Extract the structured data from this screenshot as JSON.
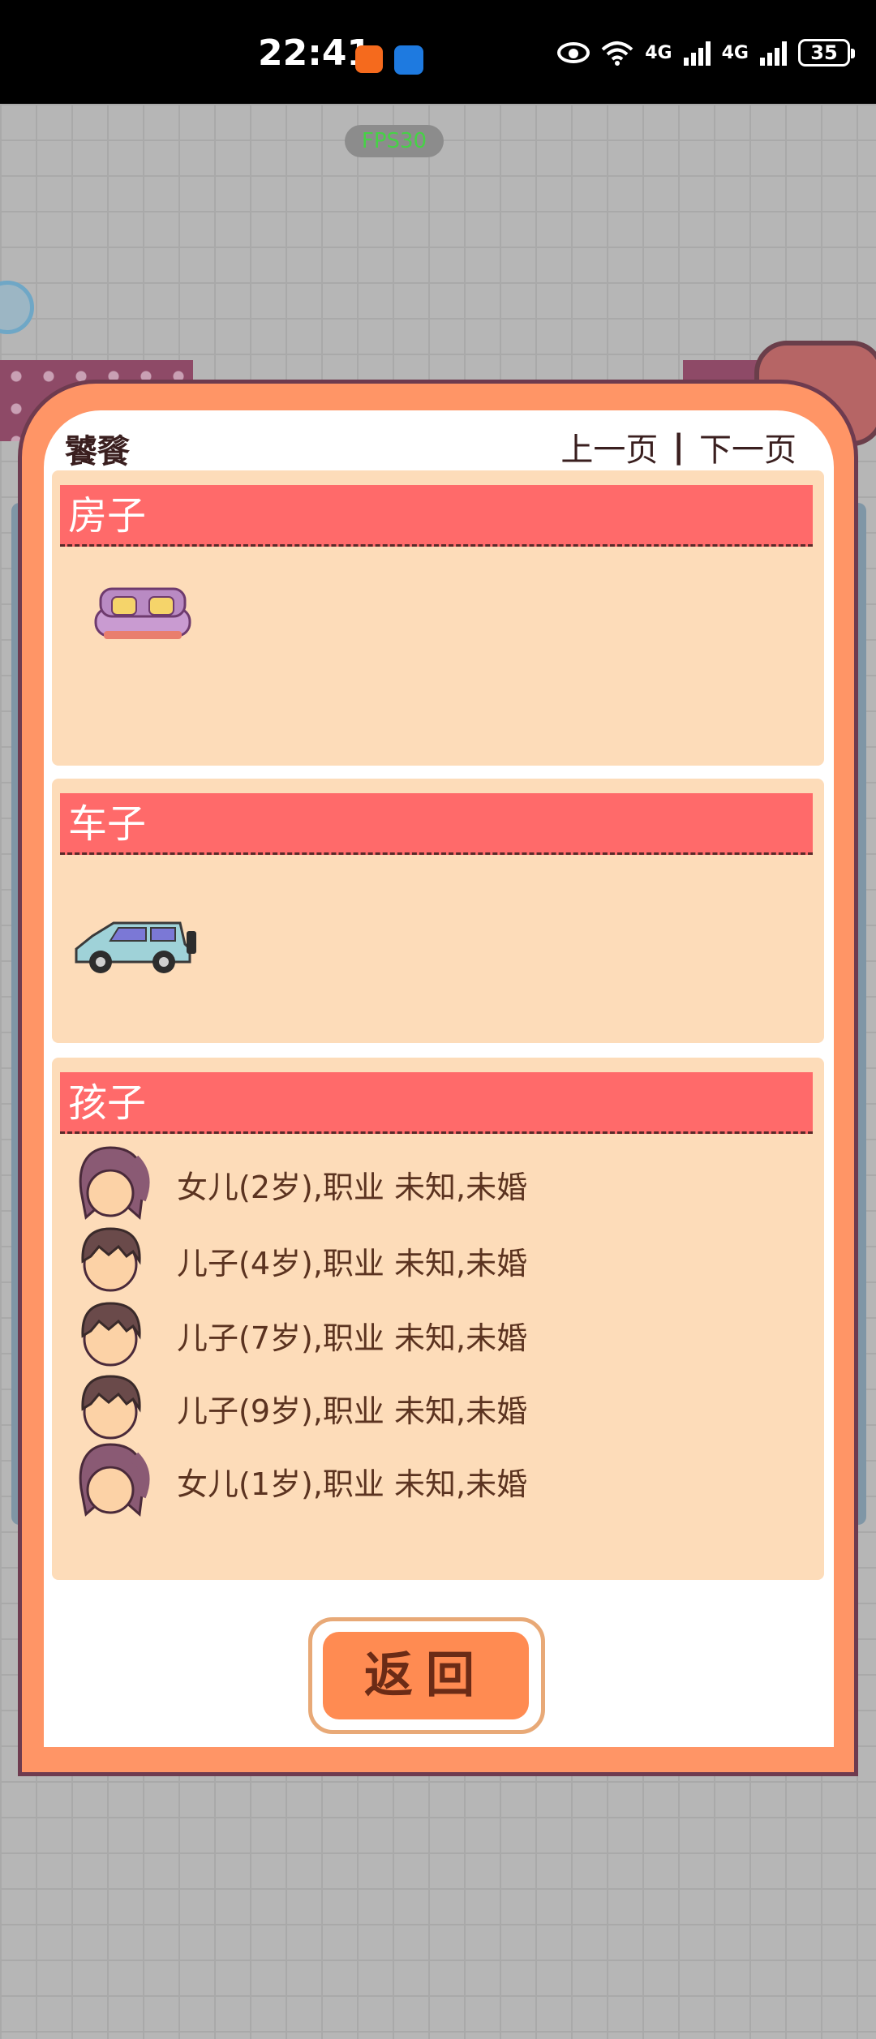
{
  "status_bar": {
    "time": "22:41",
    "network_1": "4G",
    "network_2": "4G",
    "battery": "35"
  },
  "fps_label": "FPS30",
  "dialog": {
    "player_name": "饕餮",
    "prev_page": "上一页",
    "separator": "|",
    "next_page": "下一页",
    "sections": {
      "house": {
        "title": "房子",
        "items": [
          "sofa-icon"
        ]
      },
      "car": {
        "title": "车子",
        "items": [
          "car-icon"
        ]
      },
      "children": {
        "title": "孩子",
        "list": [
          {
            "avatar": "girl-avatar-icon",
            "text": "女儿(2岁),职业 未知,未婚"
          },
          {
            "avatar": "boy-avatar-icon",
            "text": "儿子(4岁),职业 未知,未婚"
          },
          {
            "avatar": "boy-avatar-icon",
            "text": "儿子(7岁),职业 未知,未婚"
          },
          {
            "avatar": "boy-avatar-icon",
            "text": "儿子(9岁),职业 未知,未婚"
          },
          {
            "avatar": "girl-avatar-icon",
            "text": "女儿(1岁),职业 未知,未婚"
          }
        ]
      }
    },
    "return_label": "返回"
  },
  "colors": {
    "dialog_border": "#ff9566",
    "section_bg": "#fddcb9",
    "section_header": "#ff6a6a",
    "button": "#ff8b52"
  }
}
